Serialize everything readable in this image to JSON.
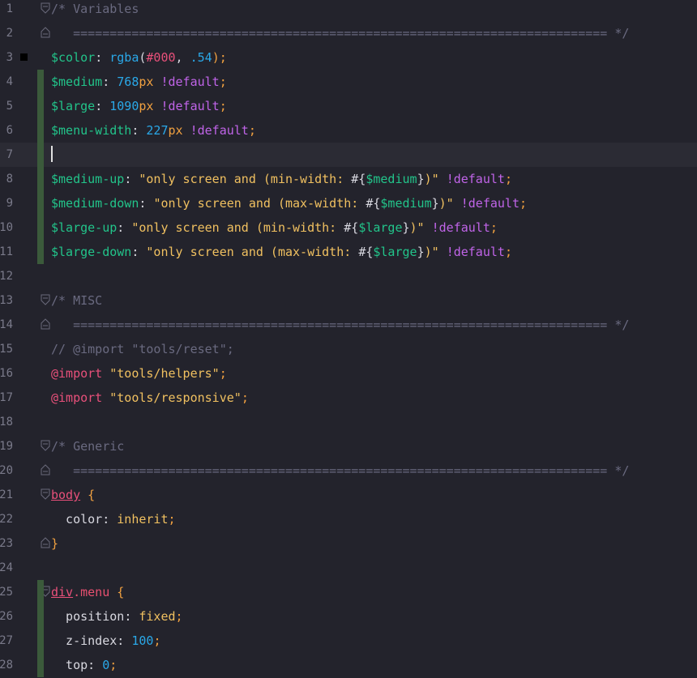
{
  "editor": {
    "line_numbers": [
      "1",
      "2",
      "3",
      "4",
      "5",
      "6",
      "7",
      "8",
      "9",
      "10",
      "11",
      "12",
      "13",
      "14",
      "15",
      "16",
      "17",
      "18",
      "19",
      "20",
      "21",
      "22",
      "23",
      "24",
      "25",
      "26",
      "27",
      "28"
    ],
    "current_line": 7,
    "lines": [
      [
        {
          "t": "/* Variables",
          "c": "cmt"
        }
      ],
      [
        {
          "t": "   ========================================================================= */",
          "c": "cmt"
        }
      ],
      [
        {
          "t": "$color",
          "c": "var"
        },
        {
          "t": ": ",
          "c": "plain"
        },
        {
          "t": "rgba",
          "c": "fn"
        },
        {
          "t": "(",
          "c": "plain"
        },
        {
          "t": "#000",
          "c": "hex"
        },
        {
          "t": ", ",
          "c": "plain"
        },
        {
          "t": ".54",
          "c": "num"
        },
        {
          "t": ");",
          "c": "semi"
        }
      ],
      [
        {
          "t": "$medium",
          "c": "var"
        },
        {
          "t": ": ",
          "c": "plain"
        },
        {
          "t": "768",
          "c": "num"
        },
        {
          "t": "px",
          "c": "unit"
        },
        {
          "t": " ",
          "c": "plain"
        },
        {
          "t": "!default",
          "c": "kw"
        },
        {
          "t": ";",
          "c": "semi"
        }
      ],
      [
        {
          "t": "$large",
          "c": "var"
        },
        {
          "t": ": ",
          "c": "plain"
        },
        {
          "t": "1090",
          "c": "num"
        },
        {
          "t": "px",
          "c": "unit"
        },
        {
          "t": " ",
          "c": "plain"
        },
        {
          "t": "!default",
          "c": "kw"
        },
        {
          "t": ";",
          "c": "semi"
        }
      ],
      [
        {
          "t": "$menu-width",
          "c": "var"
        },
        {
          "t": ": ",
          "c": "plain"
        },
        {
          "t": "227",
          "c": "num"
        },
        {
          "t": "px",
          "c": "unit"
        },
        {
          "t": " ",
          "c": "plain"
        },
        {
          "t": "!default",
          "c": "kw"
        },
        {
          "t": ";",
          "c": "semi"
        }
      ],
      [],
      [
        {
          "t": "$medium-up",
          "c": "var"
        },
        {
          "t": ": ",
          "c": "plain"
        },
        {
          "t": "\"only screen and (min-width: ",
          "c": "str"
        },
        {
          "t": "#{",
          "c": "plain"
        },
        {
          "t": "$medium",
          "c": "var"
        },
        {
          "t": "}",
          "c": "plain"
        },
        {
          "t": ")\"",
          "c": "str"
        },
        {
          "t": " ",
          "c": "plain"
        },
        {
          "t": "!default",
          "c": "kw"
        },
        {
          "t": ";",
          "c": "semi"
        }
      ],
      [
        {
          "t": "$medium-down",
          "c": "var"
        },
        {
          "t": ": ",
          "c": "plain"
        },
        {
          "t": "\"only screen and (max-width: ",
          "c": "str"
        },
        {
          "t": "#{",
          "c": "plain"
        },
        {
          "t": "$medium",
          "c": "var"
        },
        {
          "t": "}",
          "c": "plain"
        },
        {
          "t": ")\"",
          "c": "str"
        },
        {
          "t": " ",
          "c": "plain"
        },
        {
          "t": "!default",
          "c": "kw"
        },
        {
          "t": ";",
          "c": "semi"
        }
      ],
      [
        {
          "t": "$large-up",
          "c": "var"
        },
        {
          "t": ": ",
          "c": "plain"
        },
        {
          "t": "\"only screen and (min-width: ",
          "c": "str"
        },
        {
          "t": "#{",
          "c": "plain"
        },
        {
          "t": "$large",
          "c": "var"
        },
        {
          "t": "}",
          "c": "plain"
        },
        {
          "t": ")\"",
          "c": "str"
        },
        {
          "t": " ",
          "c": "plain"
        },
        {
          "t": "!default",
          "c": "kw"
        },
        {
          "t": ";",
          "c": "semi"
        }
      ],
      [
        {
          "t": "$large-down",
          "c": "var"
        },
        {
          "t": ": ",
          "c": "plain"
        },
        {
          "t": "\"only screen and (max-width: ",
          "c": "str"
        },
        {
          "t": "#{",
          "c": "plain"
        },
        {
          "t": "$large",
          "c": "var"
        },
        {
          "t": "}",
          "c": "plain"
        },
        {
          "t": ")\"",
          "c": "str"
        },
        {
          "t": " ",
          "c": "plain"
        },
        {
          "t": "!default",
          "c": "kw"
        },
        {
          "t": ";",
          "c": "semi"
        }
      ],
      [],
      [
        {
          "t": "/* MISC",
          "c": "cmt"
        }
      ],
      [
        {
          "t": "   ========================================================================= */",
          "c": "cmt"
        }
      ],
      [
        {
          "t": "// @import \"tools/reset\";",
          "c": "cmt"
        }
      ],
      [
        {
          "t": "@import",
          "c": "at"
        },
        {
          "t": " ",
          "c": "plain"
        },
        {
          "t": "\"tools/helpers\"",
          "c": "str"
        },
        {
          "t": ";",
          "c": "semi"
        }
      ],
      [
        {
          "t": "@import",
          "c": "at"
        },
        {
          "t": " ",
          "c": "plain"
        },
        {
          "t": "\"tools/responsive\"",
          "c": "str"
        },
        {
          "t": ";",
          "c": "semi"
        }
      ],
      [],
      [
        {
          "t": "/* Generic",
          "c": "cmt"
        }
      ],
      [
        {
          "t": "   ========================================================================= */",
          "c": "cmt"
        }
      ],
      [
        {
          "t": "body",
          "c": "tag"
        },
        {
          "t": " ",
          "c": "plain"
        },
        {
          "t": "{",
          "c": "brace"
        }
      ],
      [
        {
          "t": "  color",
          "c": "prop"
        },
        {
          "t": ": ",
          "c": "plain"
        },
        {
          "t": "inherit",
          "c": "val"
        },
        {
          "t": ";",
          "c": "semi"
        }
      ],
      [
        {
          "t": "}",
          "c": "brace"
        }
      ],
      [],
      [
        {
          "t": "div",
          "c": "tag"
        },
        {
          "t": ".menu",
          "c": "cls"
        },
        {
          "t": " ",
          "c": "plain"
        },
        {
          "t": "{",
          "c": "brace"
        }
      ],
      [
        {
          "t": "  position",
          "c": "prop"
        },
        {
          "t": ": ",
          "c": "plain"
        },
        {
          "t": "fixed",
          "c": "val"
        },
        {
          "t": ";",
          "c": "semi"
        }
      ],
      [
        {
          "t": "  z-index",
          "c": "prop"
        },
        {
          "t": ": ",
          "c": "plain"
        },
        {
          "t": "100",
          "c": "num"
        },
        {
          "t": ";",
          "c": "semi"
        }
      ],
      [
        {
          "t": "  top",
          "c": "prop"
        },
        {
          "t": ": ",
          "c": "plain"
        },
        {
          "t": "0",
          "c": "num"
        },
        {
          "t": ";",
          "c": "semi"
        }
      ]
    ],
    "colors": {
      "background": "#23232c",
      "current_line": "#2b2b34",
      "change_marker": "#3b5a3b",
      "comment": "#6a6a80",
      "variable": "#22c48a",
      "number": "#2aa8e8",
      "keyword": "#c064e8",
      "string": "#f0c060",
      "hex": "#e8507a"
    },
    "fold_icons": "fold-marker-icon",
    "bookmark_icon": "bookmark-icon"
  }
}
